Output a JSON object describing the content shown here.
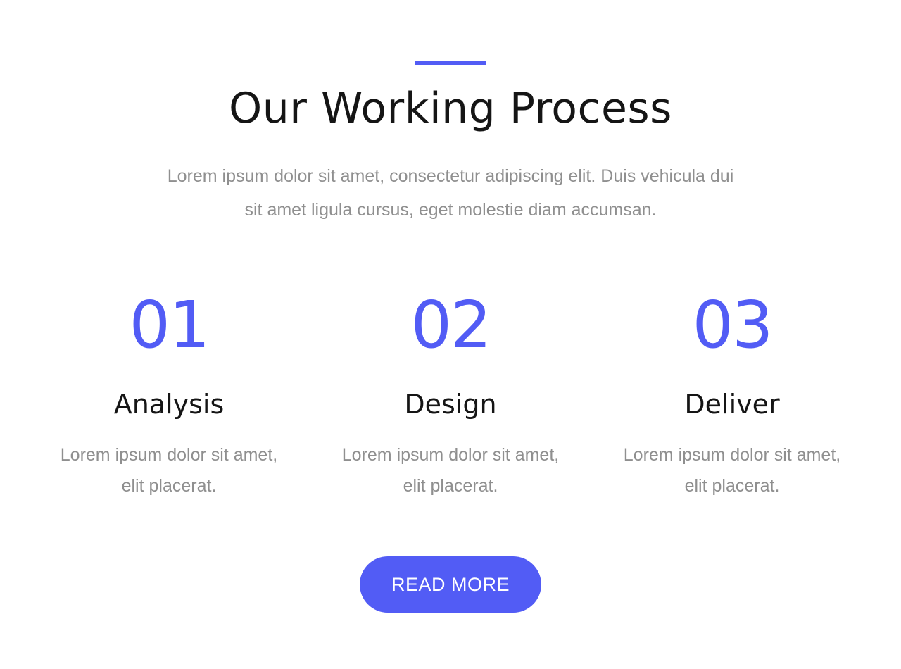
{
  "colors": {
    "accent": "#525cf5",
    "heading": "#151515",
    "body_text": "#8f8f8f",
    "background": "#ffffff"
  },
  "section": {
    "title": "Our Working Process",
    "intro_line1": "Lorem ipsum dolor sit amet, consectetur adipiscing elit. Duis vehicula dui",
    "intro_line2": "sit amet ligula cursus, eget molestie diam accumsan."
  },
  "steps": [
    {
      "number": "01",
      "title": "Analysis",
      "desc_line1": "Lorem ipsum dolor sit amet,",
      "desc_line2": "elit placerat."
    },
    {
      "number": "02",
      "title": "Design",
      "desc_line1": "Lorem ipsum dolor sit amet,",
      "desc_line2": "elit placerat."
    },
    {
      "number": "03",
      "title": "Deliver",
      "desc_line1": "Lorem ipsum dolor sit amet,",
      "desc_line2": "elit placerat."
    }
  ],
  "cta": {
    "label": "READ MORE"
  }
}
